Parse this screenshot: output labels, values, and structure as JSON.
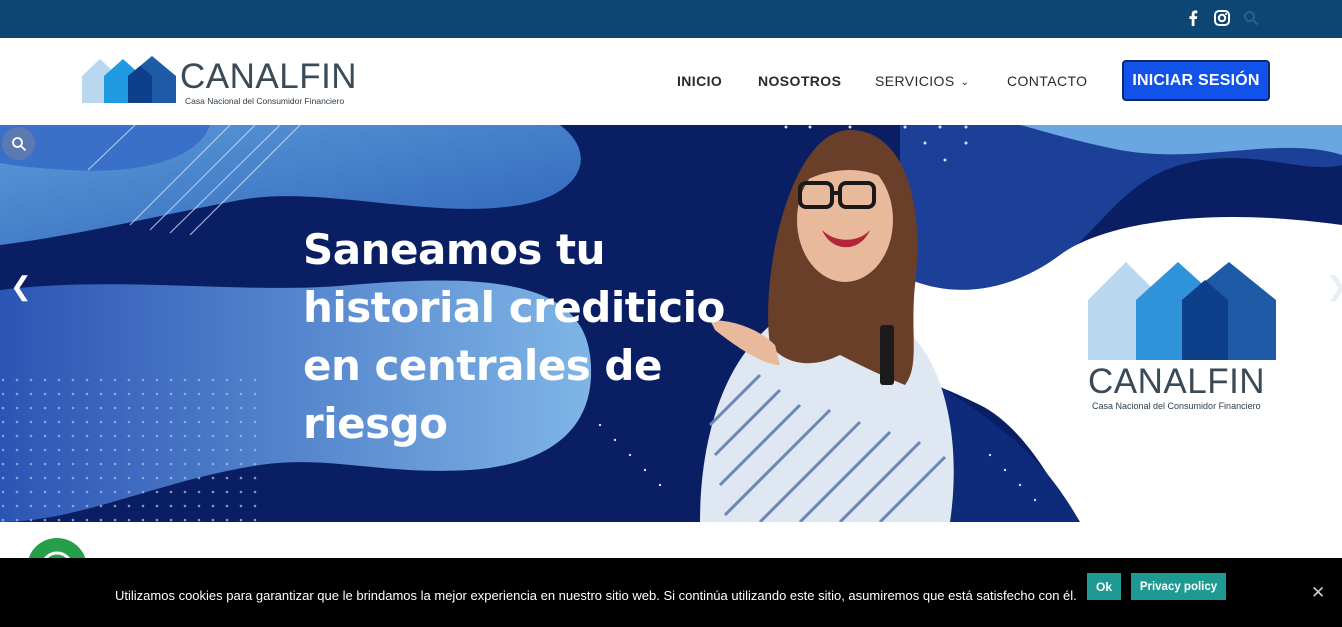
{
  "topbar": {
    "icons": [
      "facebook-icon",
      "instagram-icon",
      "search-icon"
    ],
    "bg_color": "#0e4673"
  },
  "header": {
    "brand": "CANALFIN",
    "tagline": "Casa Nacional del Consumidor Financiero",
    "nav": {
      "inicio": "INICIO",
      "nosotros": "NOSOTROS",
      "servicios": "SERVICIOS",
      "contacto": "CONTACTO"
    },
    "login_label": "INICIAR SESIÓN",
    "login_color": "#1152e8"
  },
  "hero": {
    "headline_lines": [
      "Saneamos tu",
      "historial crediticio",
      "en centrales de",
      "riesgo"
    ],
    "logo_brand": "CANALFIN",
    "logo_tagline": "Casa Nacional del Consumidor Financiero"
  },
  "cookie": {
    "message": "Utilizamos cookies para garantizar que le brindamos la mejor experiencia en nuestro sitio web. Si continúa utilizando este sitio, asumiremos que está satisfecho con él.",
    "ok_label": "Ok",
    "privacy_label": "Privacy policy",
    "close_symbol": "✕",
    "button_color": "#1e9a92"
  }
}
